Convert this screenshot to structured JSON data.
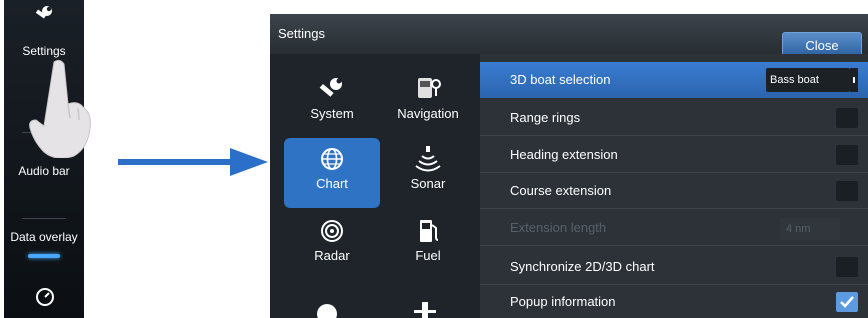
{
  "side_menu": {
    "items": [
      {
        "label": "Settings"
      },
      {
        "label": "Audio bar"
      },
      {
        "label": "Data overlay"
      }
    ]
  },
  "dialog": {
    "title": "Settings",
    "close_label": "Close",
    "categories": [
      {
        "label": "System",
        "icon": "wrench-icon"
      },
      {
        "label": "Navigation",
        "icon": "navigation-icon"
      },
      {
        "label": "Chart",
        "icon": "globe-icon",
        "selected": true
      },
      {
        "label": "Sonar",
        "icon": "sonar-icon"
      },
      {
        "label": "Radar",
        "icon": "radar-icon"
      },
      {
        "label": "Fuel",
        "icon": "fuel-icon"
      }
    ],
    "options": [
      {
        "label": "3D boat selection",
        "type": "select",
        "value": "Bass boat",
        "highlighted": true
      },
      {
        "label": "Range rings",
        "type": "checkbox",
        "checked": false
      },
      {
        "label": "Heading extension",
        "type": "checkbox",
        "checked": false
      },
      {
        "label": "Course extension",
        "type": "checkbox",
        "checked": false
      },
      {
        "label": "Extension length",
        "type": "number",
        "value": "4 nm",
        "disabled": true
      },
      {
        "label": "Synchronize 2D/3D chart",
        "type": "checkbox",
        "checked": false
      },
      {
        "label": "Popup information",
        "type": "checkbox",
        "checked": true
      }
    ]
  },
  "colors": {
    "accent": "#2f73c4",
    "highlight_row": "#3a7cd2",
    "arrow": "#2b6fc8"
  }
}
